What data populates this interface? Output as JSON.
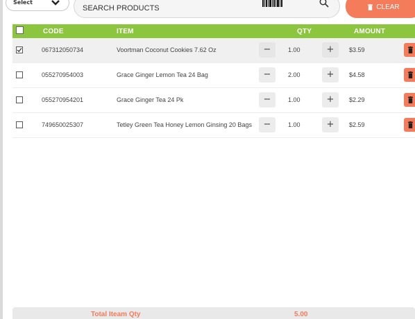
{
  "toolbar": {
    "select_label": "Select",
    "search_placeholder": "SEARCH PRODUCTS",
    "clear_label": "CLEAR"
  },
  "table": {
    "headers": {
      "code": "CODE",
      "item": "ITEM",
      "qty": "QTY",
      "amount": "AMOUNT"
    },
    "rows": [
      {
        "code": "067312050734",
        "item": "Voortman Coconut Cookies 7.62 Oz",
        "qty": "1.00",
        "amount": "$3.59",
        "checked": true
      },
      {
        "code": "055270954003",
        "item": "Grace Ginger Lemon Tea 24 Bag",
        "qty": "2.00",
        "amount": "$4.58",
        "checked": false
      },
      {
        "code": "055270954201",
        "item": "Grace Ginger Tea 24 Pk",
        "qty": "1.00",
        "amount": "$2.29",
        "checked": false
      },
      {
        "code": "749650025307",
        "item": "Tetley Green Tea Honey Lemon Ginsing 20 Bags",
        "qty": "1.00",
        "amount": "$2.59",
        "checked": false
      }
    ]
  },
  "footer": {
    "total_qty_label": "Total Iteam Qty",
    "total_qty_value": "5.00"
  },
  "colors": {
    "header_green": "#8cc63f",
    "accent_orange": "#f47c5a",
    "footer_bg": "#e9e9e9"
  },
  "icons": [
    "chevron-down-icon",
    "barcode-icon",
    "search-icon",
    "trash-icon",
    "checkbox-icon",
    "minus-icon",
    "plus-icon"
  ]
}
